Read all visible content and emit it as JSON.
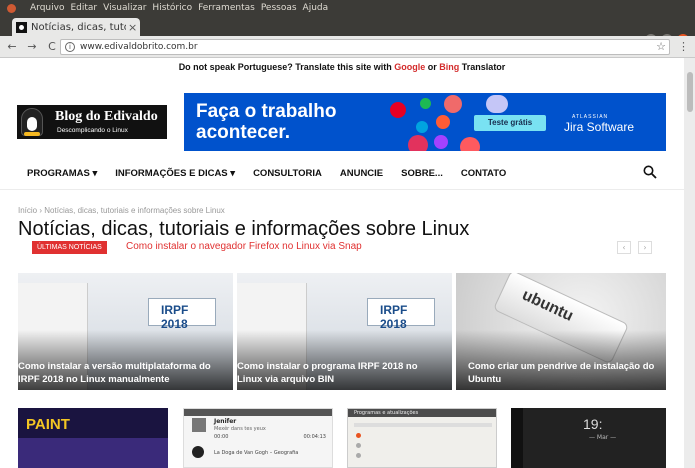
{
  "browser": {
    "menu": [
      "Arquivo",
      "Editar",
      "Visualizar",
      "Histórico",
      "Ferramentas",
      "Pessoas",
      "Ajuda"
    ],
    "tab_title": "Notícias, dicas, tuto",
    "tab_close": "×",
    "url": "www.edivaldobrito.com.br",
    "back": "←",
    "forward": "→",
    "reload": "C",
    "star": "☆",
    "kebab": "⋮",
    "info": "i",
    "win_min": "–",
    "win_max": "□",
    "win_close": "×"
  },
  "translate": {
    "prefix": "Do not speak Portuguese? Translate this site with",
    "google": "Google",
    "or": "or",
    "bing": "Bing",
    "suffix": "Translator"
  },
  "logo": {
    "line1": "Blog do Edivaldo",
    "line2": "Descomplicando o Linux"
  },
  "ad": {
    "headline_1": "Faça o trabalho",
    "headline_2": "acontecer.",
    "cta": "Teste grátis",
    "brand_small": "ATLASSIAN",
    "brand": "Jira Software",
    "icon_stripe": "stripe",
    "icon_wework": "wework",
    "icon_airbnb": "airbnb"
  },
  "nav": {
    "items": [
      "PROGRAMAS ▾",
      "INFORMAÇÕES E DICAS ▾",
      "CONSULTORIA",
      "ANUNCIE",
      "SOBRE...",
      "CONTATO"
    ],
    "search_icon": "search-icon"
  },
  "breadcrumb": {
    "home": "Início",
    "sep": "›",
    "current": "Notícias, dicas, tutoriais e informações sobre Linux"
  },
  "page_title": "Notícias, dicas, tutoriais e informações sobre Linux",
  "ticker": {
    "badge": "ÚLTIMAS NOTÍCIAS",
    "headline": "Como instalar o navegador Firefox no Linux via Snap",
    "prev": "‹",
    "next": "›"
  },
  "cards": [
    {
      "caption": "Como instalar a versão multiplataforma do IRPF 2018 no Linux manualmente",
      "irpf": "IRPF 2018"
    },
    {
      "caption": "Como instalar o programa IRPF 2018 no Linux via arquivo BIN",
      "irpf": "IRPF 2018"
    },
    {
      "caption": "Como criar um pendrive de instalação do Ubuntu",
      "brand": "ubuntu"
    }
  ],
  "bottom_thumbs": {
    "game_title": "PAINT",
    "player_title": "Jenifer",
    "player_subtitle": "Mexêr dans tes yeux",
    "player_time_start": "00:00",
    "player_time_end": "00:04:13",
    "player_next": "La Doga de Van Gogh – Geografia",
    "updates_title": "Programas e atualizações",
    "clock_time": "19:",
    "clock_date": "— Mar —"
  }
}
